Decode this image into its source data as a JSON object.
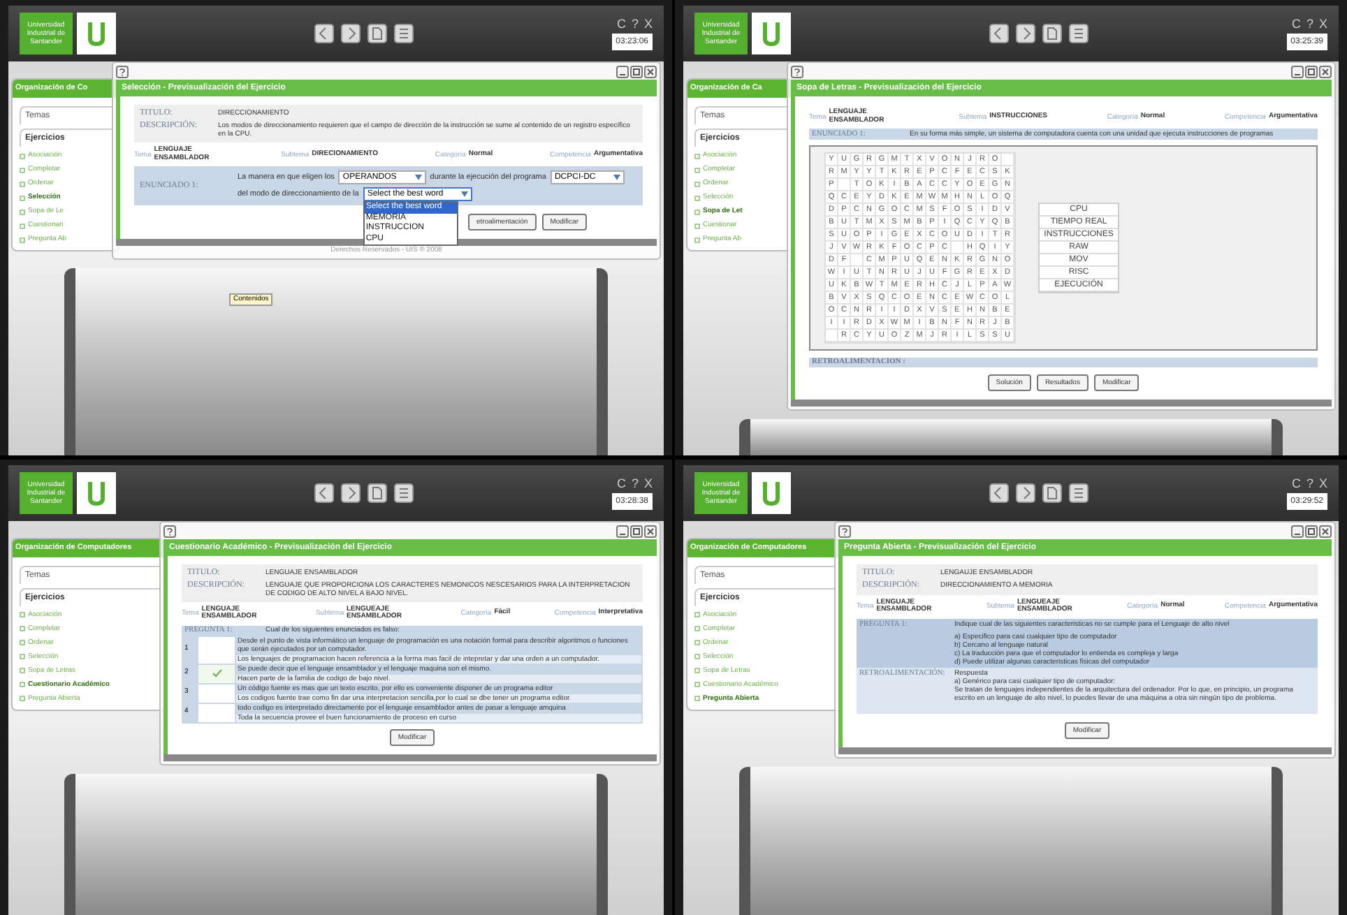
{
  "screens": [
    {
      "header": {
        "logo_text": "Universidad Industrial de Santander",
        "window_buttons": [
          "C",
          "?",
          "X"
        ],
        "clock": "03:23:06"
      },
      "sidebar": {
        "title": "Organización de Co",
        "tabs": [
          "Temas",
          "Ejercicios"
        ],
        "items": [
          {
            "label": "Asociación",
            "selected": false
          },
          {
            "label": "Completar",
            "selected": false
          },
          {
            "label": "Ordenar",
            "selected": false
          },
          {
            "label": "Selección",
            "selected": true
          },
          {
            "label": "Sopa de Le",
            "selected": false
          },
          {
            "label": "Cuestionari",
            "selected": false
          },
          {
            "label": "Pregunta Ab",
            "selected": false
          }
        ]
      },
      "dialog": {
        "kind": "fill_in",
        "title": "Selección - Previsualización del Ejercicio",
        "info": [
          {
            "label": "TITULO:",
            "value": "DIRECCIONAMIENTO"
          },
          {
            "label": "DESCRIPCIÓN:",
            "value": "Los modos de direccionamiento requieren que el campo de dirección de la instrucción se sume al contenido de un registro específico en la CPU."
          }
        ],
        "meta": [
          {
            "label": "Tema",
            "value": "LENGUAJE ENSAMBLADOR"
          },
          {
            "label": "Subtema",
            "value": "DIRECIONAMIENTO"
          },
          {
            "label": "Categoría",
            "value": "Normal"
          },
          {
            "label": "Competencia",
            "value": "Argumentativa"
          }
        ],
        "prompt_label": "ENUNCIADO 1:",
        "parts": [
          {
            "kind": "text",
            "text": "La manera en que eligen los"
          },
          {
            "kind": "select",
            "value": "OPERANDOS",
            "open": false
          },
          {
            "kind": "text",
            "text": "durante la ejecución del programa"
          },
          {
            "kind": "select",
            "value": "DCPCI-DC",
            "open": false
          },
          {
            "kind": "text",
            "text": "del modo de direccionamiento de la"
          },
          {
            "kind": "select",
            "value": "Select the best word",
            "open": true,
            "options": [
              {
                "label": "Select the best word",
                "selected": true
              },
              {
                "label": "MEMORIA",
                "selected": false
              },
              {
                "label": "INSTRUCCION",
                "selected": false
              },
              {
                "label": "CPU",
                "selected": false
              }
            ]
          }
        ],
        "buttons": [
          "etroalimentación",
          "Modificar"
        ],
        "footer": "Derechos Reservados - UIS ® 2008"
      },
      "desk_label": "Contenidos"
    },
    {
      "header": {
        "logo_text": "Universidad Industrial de Santander",
        "window_buttons": [
          "C",
          "?",
          "X"
        ],
        "clock": "03:25:39"
      },
      "sidebar": {
        "title": "Organización de Ca",
        "tabs": [
          "Temas",
          "Ejercicios"
        ],
        "items": [
          {
            "label": "Asociación",
            "selected": false
          },
          {
            "label": "Completar",
            "selected": false
          },
          {
            "label": "Ordenar",
            "selected": false
          },
          {
            "label": "Selección",
            "selected": false
          },
          {
            "label": "Sopa de Let",
            "selected": true
          },
          {
            "label": "Cuestionar",
            "selected": false
          },
          {
            "label": "Pregunta Ab",
            "selected": false
          }
        ]
      },
      "dialog": {
        "kind": "word_search",
        "title": "Sopa de Letras - Previsualización del Ejercicio",
        "meta": [
          {
            "label": "Tema",
            "value": "LENGUAJE ENSAMBLADOR"
          },
          {
            "label": "Subtema",
            "value": "INSTRUCCIONES"
          },
          {
            "label": "Categoría",
            "value": "Normal"
          },
          {
            "label": "Competencia",
            "value": "Argumentativa"
          }
        ],
        "prompt_label": "ENUNCIADO 1:",
        "prompt": "En su forma más simple, un sistema de computadora cuenta con una unidad que ejecuta instrucciones de programas",
        "grid": [
          [
            "Y",
            "U",
            "G",
            "R",
            "G",
            "M",
            "T",
            "X",
            "V",
            "O",
            "N",
            "J",
            "R",
            "O",
            {
              "kind": "blank"
            }
          ],
          [
            "R",
            "M",
            "Y",
            "Y",
            "T",
            "K",
            "R",
            "E",
            "P",
            "C",
            "F",
            "E",
            "C",
            "S",
            "K"
          ],
          [
            "P",
            {
              "kind": "blank"
            },
            "T",
            "O",
            "K",
            "I",
            "B",
            "A",
            "C",
            "C",
            "Y",
            "O",
            "E",
            "G",
            "N"
          ],
          [
            "Q",
            "C",
            "E",
            "Y",
            "D",
            "K",
            "E",
            "M",
            "W",
            "M",
            "H",
            "N",
            "L",
            "O",
            "Q"
          ],
          [
            "D",
            "P",
            "C",
            "N",
            "G",
            "O",
            "C",
            "M",
            "S",
            "F",
            "O",
            "S",
            "I",
            "D",
            "V"
          ],
          [
            "B",
            "U",
            "T",
            "M",
            "X",
            "S",
            "M",
            "B",
            "P",
            "I",
            "Q",
            "C",
            "Y",
            "Q",
            "B"
          ],
          [
            "S",
            "U",
            "O",
            "P",
            "I",
            "G",
            "E",
            "X",
            "C",
            "O",
            "U",
            "D",
            "I",
            "T",
            "R"
          ],
          [
            "J",
            "V",
            "W",
            "R",
            "K",
            "F",
            "O",
            "C",
            "P",
            "C",
            {
              "kind": "blank"
            },
            "H",
            "Q",
            "I",
            "Y"
          ],
          [
            "D",
            "F",
            {
              "kind": "blank"
            },
            "C",
            "M",
            "P",
            "U",
            "Q",
            "E",
            "N",
            "K",
            "R",
            "G",
            "N",
            "O"
          ],
          [
            "W",
            "I",
            "U",
            "T",
            "N",
            "R",
            "U",
            "J",
            "U",
            "F",
            "G",
            "R",
            "E",
            "X",
            "D"
          ],
          [
            "U",
            "K",
            "B",
            "W",
            "T",
            "M",
            "E",
            "R",
            "H",
            "C",
            "J",
            "L",
            "P",
            "A",
            "W"
          ],
          [
            "B",
            "V",
            "X",
            "S",
            "Q",
            "C",
            "O",
            "E",
            "N",
            "C",
            "E",
            "W",
            "C",
            "O",
            "L"
          ],
          [
            "O",
            "C",
            "N",
            "R",
            "I",
            "I",
            "D",
            "X",
            "V",
            "S",
            "E",
            "H",
            "N",
            "B",
            "E"
          ],
          [
            "I",
            "I",
            "R",
            "D",
            "X",
            "W",
            "M",
            "I",
            "B",
            "N",
            "F",
            "N",
            "R",
            "J",
            "B"
          ],
          [
            {
              "kind": "blank"
            },
            "R",
            "C",
            "Y",
            "U",
            "O",
            "Z",
            "M",
            "J",
            "R",
            "I",
            "L",
            "S",
            "S",
            "U"
          ]
        ],
        "words": [
          "CPU",
          "TIEMPO REAL",
          "INSTRUCCIONES",
          "RAW",
          "MOV",
          "RISC",
          "EJECUCIÓN"
        ],
        "feedback_label": "RETROALIMENTACION :",
        "buttons": [
          "Solución",
          "Resultados",
          "Modificar"
        ]
      }
    },
    {
      "header": {
        "logo_text": "Universidad Industrial de Santander",
        "window_buttons": [
          "C",
          "?",
          "X"
        ],
        "clock": "03:28:38"
      },
      "sidebar": {
        "title": "Organización de Computadores",
        "tabs": [
          "Temas",
          "Ejercicios"
        ],
        "items": [
          {
            "label": "Asociación",
            "selected": false
          },
          {
            "label": "Completar",
            "selected": false
          },
          {
            "label": "Ordenar",
            "selected": false
          },
          {
            "label": "Selección",
            "selected": false
          },
          {
            "label": "Sopa de Letras",
            "selected": false
          },
          {
            "label": "Cuestionario Académico",
            "selected": true
          },
          {
            "label": "Pregunta Abierta",
            "selected": false
          }
        ]
      },
      "dialog": {
        "kind": "multiple_choice",
        "title": "Cuestionario Académico - Previsualización del Ejercicio",
        "info": [
          {
            "label": "TITULO:",
            "value": "LENGUAJE ENSAMBLADOR"
          },
          {
            "label": "DESCRIPCIÓN:",
            "value": "LENGUAJE QUE PROPORCIONA LOS CARACTERES NEMONICOS NESCESARIOS PARA LA INTERPRETACION DE CODIGO DE ALTO NIVEL A BAJO NIVEL."
          }
        ],
        "meta": [
          {
            "label": "Tema",
            "value": "LENGUAJE ENSAMBLADOR"
          },
          {
            "label": "Subtema",
            "value": "LENGUEAJE ENSAMBLADOR"
          },
          {
            "label": "Categoría",
            "value": "Fácil"
          },
          {
            "label": "Competencia",
            "value": "Interpretativa"
          }
        ],
        "prompt_label": "PREGUNTA 1:",
        "prompt": "Cual de los siguientes enunciados es falso:",
        "options": [
          {
            "number": "1",
            "selected": false,
            "statements": [
              "Desde el punto de vista informático un lenguaje de programación es una notación formal para describir algoritmos o funciones que serán ejecutados por un computador.",
              "Los lenguajes de programacion hacen referencia a la forma mas facil de intepretar y dar una orden a un computador."
            ]
          },
          {
            "number": "2",
            "selected": true,
            "statements": [
              "Se puede decir que el lenguaje ensamblador y el lenguaje maquina son el mismo.",
              "Hacen parte de la familia de codigo de bajo nivel."
            ]
          },
          {
            "number": "3",
            "selected": false,
            "statements": [
              "Un código fuente es mas que un texto escrito, por ello es conveniente disponer de un programa editor",
              "Los codigos fuente trae como fin dar una interpretacion sencilla,por lo cual se dbe tener un programa editor."
            ]
          },
          {
            "number": "4",
            "selected": false,
            "statements": [
              "todo codigo es interpretado directamente por el lenguaje ensamblador antes de pasar a lenguaje amquina",
              "Toda la secuencia provee el buen funcionamiento de proceso en curso"
            ]
          }
        ],
        "buttons": [
          "Modificar"
        ]
      }
    },
    {
      "header": {
        "logo_text": "Universidad Industrial de Santander",
        "window_buttons": [
          "C",
          "?",
          "X"
        ],
        "clock": "03:29:52"
      },
      "sidebar": {
        "title": "Organización de Computadores",
        "tabs": [
          "Temas",
          "Ejercicios"
        ],
        "items": [
          {
            "label": "Asociación",
            "selected": false
          },
          {
            "label": "Completar",
            "selected": false
          },
          {
            "label": "Ordenar",
            "selected": false
          },
          {
            "label": "Selección",
            "selected": false
          },
          {
            "label": "Sopa de Letras",
            "selected": false
          },
          {
            "label": "Cuestionario Académico",
            "selected": false
          },
          {
            "label": "Pregunta Abierta",
            "selected": true
          }
        ]
      },
      "dialog": {
        "kind": "open_question",
        "title": "Pregunta Abierta - Previsualización del Ejercicio",
        "info": [
          {
            "label": "TITULO:",
            "value": "LENGAUJE ENSAMBLADOR"
          },
          {
            "label": "DESCRIPCIÓN:",
            "value": "DIRECCIONAMIENTO A MEMORIA"
          }
        ],
        "meta": [
          {
            "label": "Tema",
            "value": "LENGUAJE ENSAMBLADOR"
          },
          {
            "label": "Subtema",
            "value": "LENGUEAJE ENSAMBLADOR"
          },
          {
            "label": "Categoría",
            "value": "Normal"
          },
          {
            "label": "Competencia",
            "value": "Argumentativa"
          }
        ],
        "prompt_label": "PREGUNTA 1:",
        "prompt": "Indique cual de las siguientes caracteristicas no se cumple para el Lenguaje de alto nivel",
        "choices": [
          "a) Especifico para casi cualquier tipo de computador",
          "b) Cercano al lenguaje natural",
          "c) La traducción para que el computador lo entienda es compleja y larga",
          "d) Puede utilizar algunas caracteristicas fisicas del computador"
        ],
        "feedback_label": "RETROALIMENTACIÓN:",
        "feedback": [
          "Respuesta",
          "a) Genérico para casi cualquier tipo de computador:",
          "Se tratan de lenguajes independientes de la arquitectura del ordenador. Por lo que, en principio, un programa escrito en un lenguaje de alto nivel, lo puedes llevar de una máquina a otra sin ningún tipo de problema."
        ],
        "buttons": [
          "Modificar"
        ]
      }
    }
  ]
}
